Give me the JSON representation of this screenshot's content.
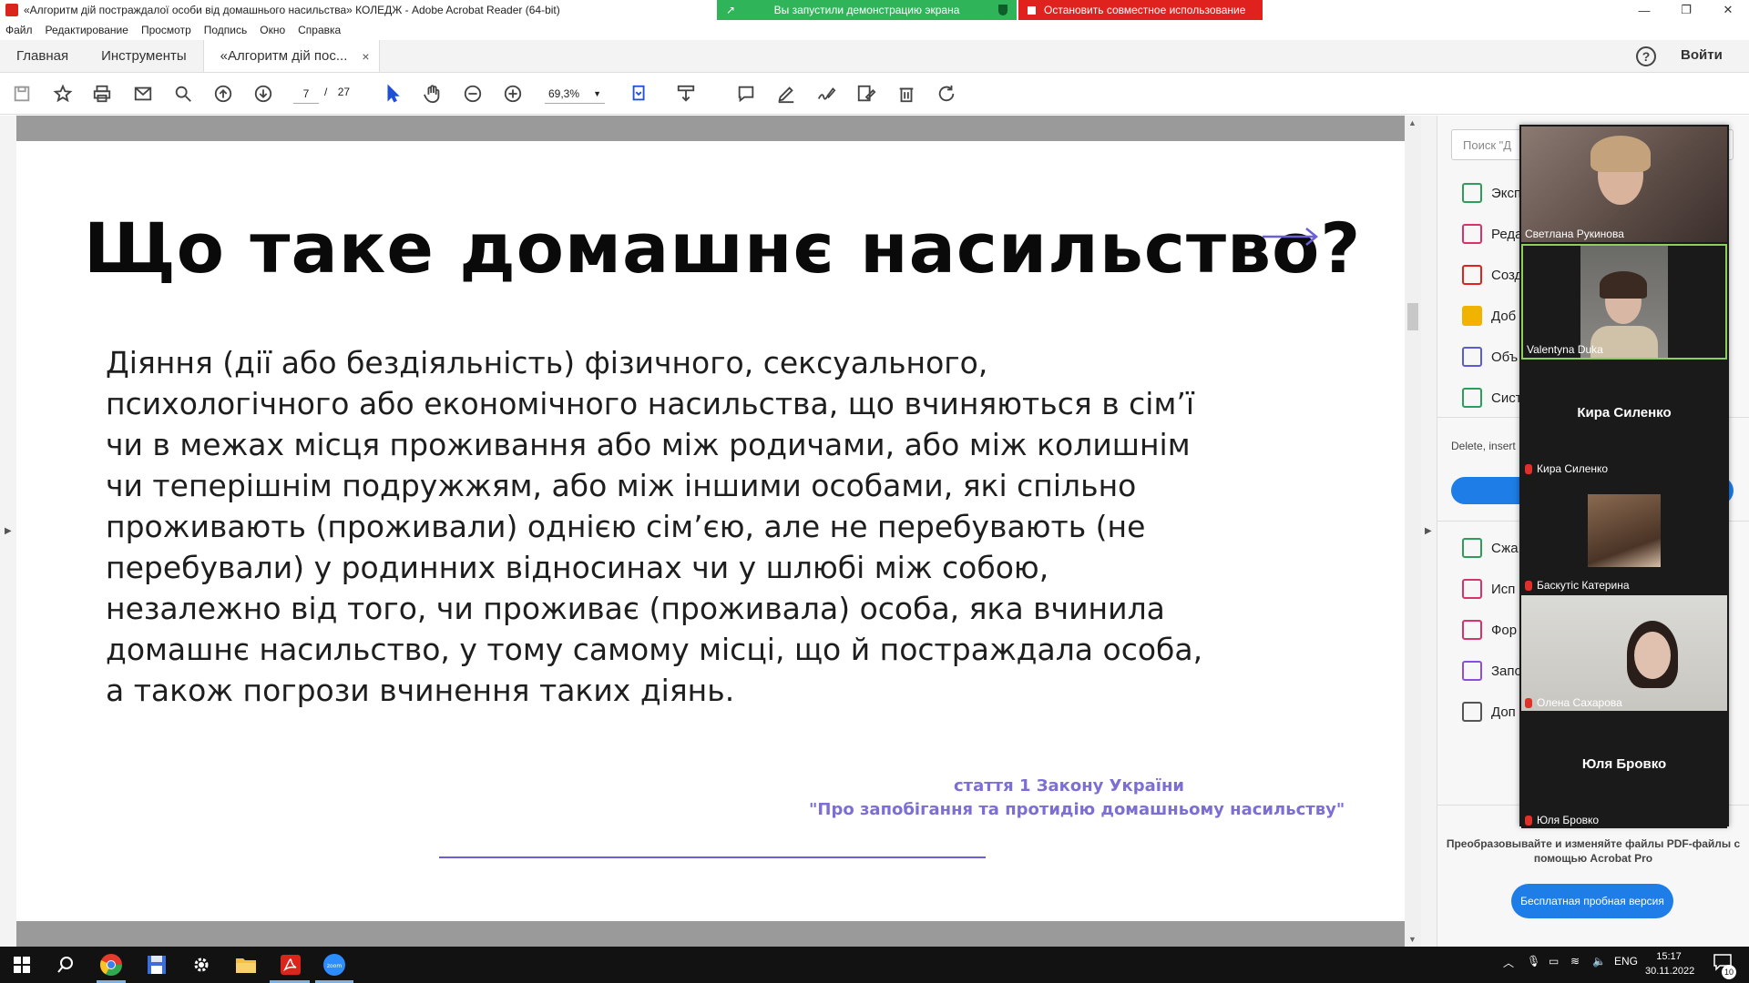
{
  "window": {
    "title": "«Алгоритм дій постраждалої особи від домашнього насильства» КОЛЕДЖ - Adobe Acrobat Reader (64-bit)",
    "share_status": "Вы запустили демонстрацию экрана",
    "stop_share": "Остановить совместное использование"
  },
  "menu": [
    "Файл",
    "Редактирование",
    "Просмотр",
    "Подпись",
    "Окно",
    "Справка"
  ],
  "tabs": {
    "home": "Главная",
    "tools": "Инструменты",
    "doc": "«Алгоритм дій пос...",
    "close": "×"
  },
  "header": {
    "help": "?",
    "login": "Войти"
  },
  "toolbar": {
    "page_current": "7",
    "page_sep": "/",
    "page_total": "27",
    "zoom": "69,3%"
  },
  "slide": {
    "title": "Що таке домашнє насильство?",
    "body_lines": [
      "Діяння (дії або бездіяльність) фізичного, сексуального,",
      "психологічного або економічного насильства, що вчиняються в сім’ї",
      "чи в межах місця проживання або між родичами, або між колишнім",
      "чи теперішнім подружжям, або між іншими особами, які спільно",
      "проживають (проживали) однією сім’єю, але не перебувають (не",
      "перебували) у родинних відносинах чи у шлюбі між собою,",
      "незалежно від того, чи проживає (проживала) особа, яка вчинила",
      "домашнє насильство, у тому самому місці, що й постраждала особа,",
      "а також погрози вчинення таких діянь."
    ],
    "citation_line1": "стаття 1 Закону України",
    "citation_line2": "\"Про запобігання та протидію домашньому насильству\"",
    "accent_color": "#7b6fd6"
  },
  "right_panel": {
    "search_placeholder": "Поиск \"Д",
    "tools": [
      {
        "label": "Эксп",
        "icon": "export-pdf-icon",
        "color": "#2e9c5a"
      },
      {
        "label": "Реда",
        "icon": "edit-pdf-icon",
        "color": "#d6336c"
      },
      {
        "label": "Созд",
        "icon": "create-pdf-icon",
        "color": "#e0221e"
      },
      {
        "label": "Доб",
        "icon": "comment-icon",
        "color": "#f0b400"
      },
      {
        "label": "Объ",
        "icon": "combine-icon",
        "color": "#5b5bd6"
      },
      {
        "label": "Сист",
        "icon": "organize-icon",
        "color": "#2e9c5a"
      }
    ],
    "note": "Delete, insert",
    "tools2": [
      {
        "label": "Сжа",
        "icon": "compress-icon",
        "color": "#2e9c5a"
      },
      {
        "label": "Исп",
        "icon": "fill-sign-icon",
        "color": "#d6336c"
      },
      {
        "label": "Фор",
        "icon": "form-icon",
        "color": "#d6336c"
      },
      {
        "label": "Запо",
        "icon": "sign-icon",
        "color": "#8a4fd6"
      },
      {
        "label": "Доп",
        "icon": "more-tools-icon",
        "color": "#555555"
      }
    ],
    "promo": "Преобразовывайте и изменяйте файлы PDF-файлы с помощью Acrobat Pro",
    "trial_button": "Бесплатная пробная версия"
  },
  "participants": [
    {
      "name": "Светлана Рукинова",
      "video": true,
      "muted": false
    },
    {
      "name": "Valentyna Duka",
      "video": true,
      "muted": false,
      "speaking": true
    },
    {
      "name": "Кира Силенко",
      "video": false,
      "muted": true
    },
    {
      "name": "Баскутіс Катерина",
      "video": true,
      "muted": true
    },
    {
      "name": "Олена Сахарова",
      "video": true,
      "muted": true
    },
    {
      "name": "Юля Бровко",
      "video": false,
      "muted": true
    }
  ],
  "taskbar": {
    "lang": "ENG",
    "time": "15:17",
    "date": "30.11.2022",
    "notifications": "10",
    "zoom_label": "zoom"
  }
}
